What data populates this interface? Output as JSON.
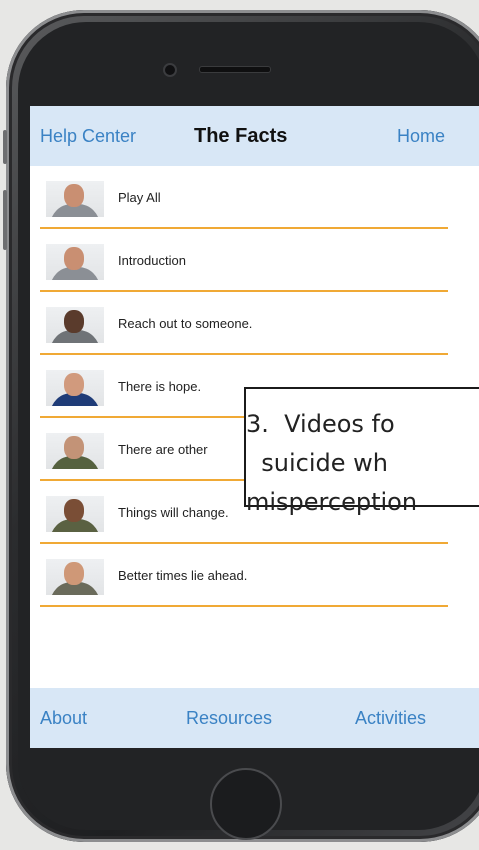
{
  "navbar": {
    "back_label": "Help Center",
    "title": "The Facts",
    "home_label": "Home"
  },
  "videos": [
    {
      "label": "Play All",
      "skin": "#c98f72",
      "shirt": "#8b8f95"
    },
    {
      "label": "Introduction",
      "skin": "#c98f72",
      "shirt": "#8b8f95"
    },
    {
      "label": "Reach out to someone.",
      "skin": "#5a3b2c",
      "shirt": "#6f7377"
    },
    {
      "label": "There is hope.",
      "skin": "#d19a7d",
      "shirt": "#1f3c78"
    },
    {
      "label": "There are other",
      "skin": "#c39377",
      "shirt": "#55613f"
    },
    {
      "label": "Things will change.",
      "skin": "#7a4e36",
      "shirt": "#5a6142"
    },
    {
      "label": "Better times lie ahead.",
      "skin": "#cf9877",
      "shirt": "#6a6b5b"
    }
  ],
  "tabbar": {
    "about_label": "About",
    "resources_label": "Resources",
    "activities_label": "Activities"
  },
  "callout": {
    "text": "3.  Videos fo\n  suicide wh\nmisperception"
  },
  "colors": {
    "accent": "#3a82c4",
    "bar_bg": "#d8e7f6",
    "divider": "#f0a935"
  }
}
